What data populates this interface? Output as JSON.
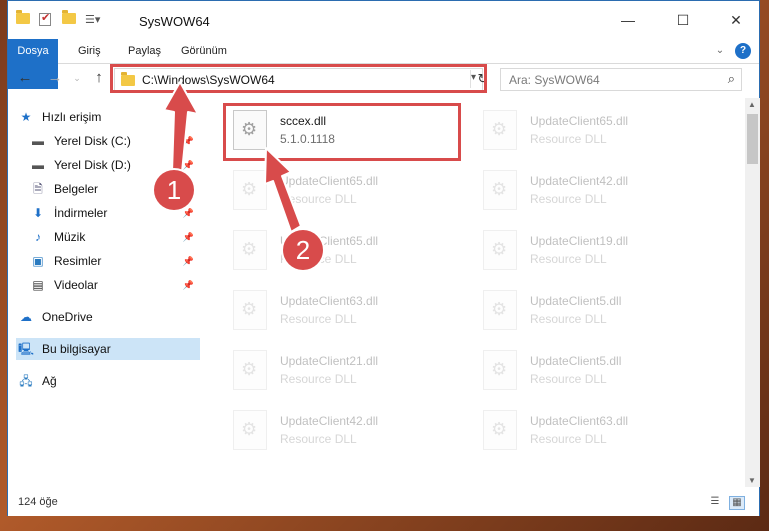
{
  "window": {
    "title": "SysWOW64"
  },
  "ribbon": {
    "tabs": [
      "Dosya",
      "Giriş",
      "Paylaş",
      "Görünüm"
    ]
  },
  "address": {
    "path": "C:\\Windows\\SysWOW64",
    "search_placeholder": "Ara: SysWOW64"
  },
  "sidebar": {
    "items": [
      {
        "label": "Hızlı erişim",
        "icon": "star-icon"
      },
      {
        "label": "Yerel Disk (C:)",
        "icon": "drive-icon"
      },
      {
        "label": "Yerel Disk (D:)",
        "icon": "drive-icon"
      },
      {
        "label": "Belgeler",
        "icon": "documents-icon"
      },
      {
        "label": "İndirmeler",
        "icon": "download-icon"
      },
      {
        "label": "Müzik",
        "icon": "music-icon"
      },
      {
        "label": "Resimler",
        "icon": "pictures-icon"
      },
      {
        "label": "Videolar",
        "icon": "video-icon"
      },
      {
        "label": "OneDrive",
        "icon": "cloud-icon"
      },
      {
        "label": "Bu bilgisayar",
        "icon": "computer-icon"
      },
      {
        "label": "Ağ",
        "icon": "network-icon"
      }
    ]
  },
  "files": [
    {
      "name": "sccex.dll",
      "sub": "5.1.0.1118"
    },
    {
      "name": "UpdateClient65.dll",
      "sub": "Resource DLL"
    },
    {
      "name": "UpdateClient65.dll",
      "sub": "Resource DLL"
    },
    {
      "name": "UpdateClient42.dll",
      "sub": "Resource DLL"
    },
    {
      "name": "UpdateClient65.dll",
      "sub": "Resource DLL"
    },
    {
      "name": "UpdateClient19.dll",
      "sub": "Resource DLL"
    },
    {
      "name": "UpdateClient63.dll",
      "sub": "Resource DLL"
    },
    {
      "name": "UpdateClient5.dll",
      "sub": "Resource DLL"
    },
    {
      "name": "UpdateClient21.dll",
      "sub": "Resource DLL"
    },
    {
      "name": "UpdateClient5.dll",
      "sub": "Resource DLL"
    },
    {
      "name": "UpdateClient42.dll",
      "sub": "Resource DLL"
    },
    {
      "name": "UpdateClient63.dll",
      "sub": "Resource DLL"
    }
  ],
  "status": {
    "count": "124 öğe"
  },
  "annotations": {
    "badge1": "1",
    "badge2": "2",
    "color": "#d84b4b"
  }
}
